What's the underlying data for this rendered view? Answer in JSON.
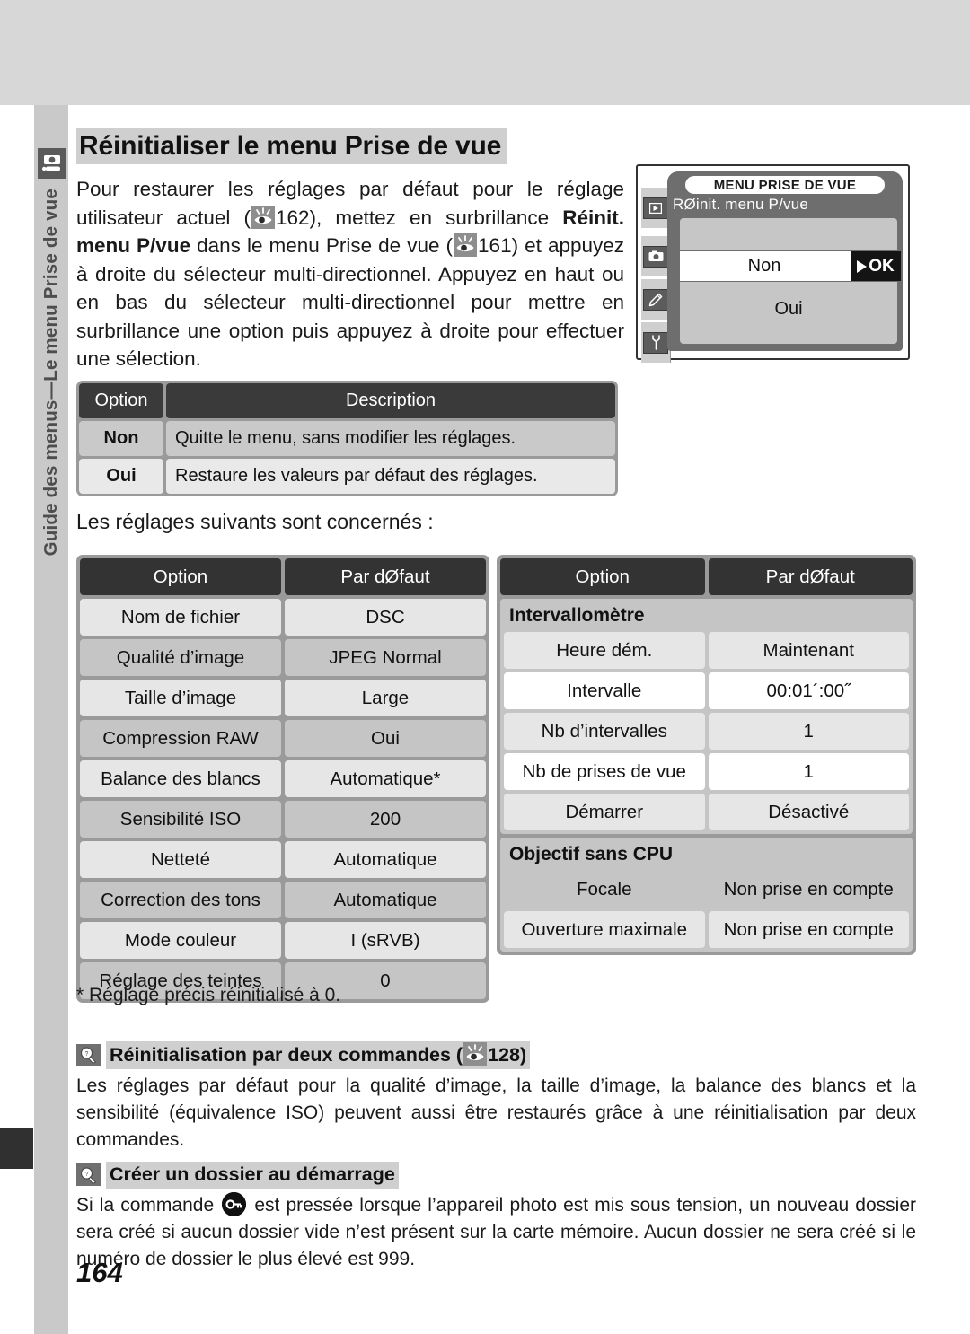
{
  "rail": {
    "label": "Guide des menus—Le menu Prise de vue",
    "icon": "camera-icon"
  },
  "page": {
    "title": "Réinitialiser le menu Prise de vue",
    "number": "164"
  },
  "intro": {
    "p1": "Pour restaurer les réglages par défaut pour le réglage utilisateur actuel (",
    "ref1": "162",
    "p2": "), mettez en surbrillance ",
    "bold1": "Réinit. menu P/vue",
    "p3": " dans le menu Prise de vue (",
    "ref2": "161",
    "p4": ") et appuyez à droite du sélecteur multi-directionnel. Appuyez en haut ou en bas du sélecteur multi-directionnel pour mettre en surbrillance une option puis appuyez à droite pour effectuer une sélection."
  },
  "lcd": {
    "title": "MENU PRISE DE VUE",
    "subtitle": "RØinit. menu P/vue",
    "selected_option": "Non",
    "ok_label": "OK",
    "second_option": "Oui",
    "tabs": [
      {
        "name": "playback-tab",
        "glyph": "play-icon"
      },
      {
        "name": "shooting-tab",
        "glyph": "camera-icon"
      },
      {
        "name": "custom-tab",
        "glyph": "pencil-icon"
      },
      {
        "name": "setup-tab",
        "glyph": "wrench-icon"
      }
    ]
  },
  "option_table": {
    "headers": [
      "Option",
      "Description"
    ],
    "rows": [
      {
        "option": "Non",
        "description": "Quitte le menu, sans modifier les réglages."
      },
      {
        "option": "Oui",
        "description": "Restaure les valeurs par défaut des réglages."
      }
    ]
  },
  "leadin": "Les réglages suivants sont concernés :",
  "defaults_left": {
    "headers": [
      "Option",
      "Par dØfaut"
    ],
    "rows": [
      {
        "option": "Nom de fichier",
        "value": "DSC"
      },
      {
        "option": "Qualité d’image",
        "value": "JPEG Normal"
      },
      {
        "option": "Taille d’image",
        "value": "Large"
      },
      {
        "option": "Compression RAW",
        "value": "Oui"
      },
      {
        "option": "Balance des blancs",
        "value": "Automatique*"
      },
      {
        "option": "Sensibilité ISO",
        "value": "200"
      },
      {
        "option": "Netteté",
        "value": "Automatique"
      },
      {
        "option": "Correction des tons",
        "value": "Automatique"
      },
      {
        "option": "Mode couleur",
        "value": "I (sRVB)"
      },
      {
        "option": "Réglage des teintes",
        "value": "0"
      }
    ]
  },
  "defaults_right": {
    "headers": [
      "Option",
      "Par dØfaut"
    ],
    "groups": [
      {
        "title": "Intervallomètre",
        "rows": [
          {
            "option": "Heure dém.",
            "value": "Maintenant"
          },
          {
            "option": "Intervalle",
            "value": "00:01´:00˝"
          },
          {
            "option": "Nb d’intervalles",
            "value": "1"
          },
          {
            "option": "Nb de prises de vue",
            "value": "1"
          },
          {
            "option": "Démarrer",
            "value": "Désactivé"
          }
        ]
      },
      {
        "title": "Objectif sans CPU",
        "rows": [
          {
            "option": "Focale",
            "value": "Non prise en compte"
          },
          {
            "option": "Ouverture maximale",
            "value": "Non prise en compte"
          }
        ]
      }
    ]
  },
  "footnote": "* Réglage précis réinitialisé à 0.",
  "notes": [
    {
      "icon": "tip-icon",
      "heading_pre": "Réinitialisation par deux commandes (",
      "heading_ref": "128",
      "heading_post": ")",
      "body": "Les réglages par défaut pour la qualité d’image, la taille d’image, la balance des blancs et la sensibilité (équivalence ISO) peuvent aussi être restaurés grâce à une réinitialisation par deux commandes."
    },
    {
      "icon": "tip-icon",
      "heading": "Créer un dossier au démarrage",
      "body_pre": "Si la commande ",
      "body_icon": "format-key-icon",
      "body_post": " est pressée lorsque l’appareil photo est mis sous tension, un nouveau dossier sera créé si aucun dossier vide n’est présent sur la carte mémoire. Aucun dossier ne sera créé si le numéro de dossier le plus élevé est 999."
    }
  ]
}
